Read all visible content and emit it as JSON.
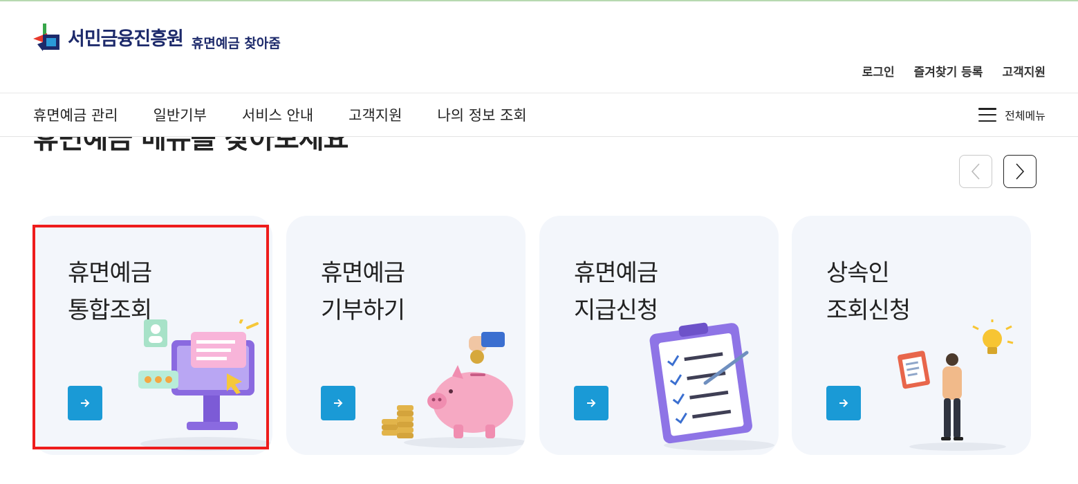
{
  "logo": {
    "org_name": "서민금융진흥원",
    "service_name": "휴면예금 찾아줌"
  },
  "util_links": [
    "로그인",
    "즐겨찾기 등록",
    "고객지원"
  ],
  "gnb": {
    "items": [
      "휴면예금 관리",
      "일반기부",
      "서비스 안내",
      "고객지원",
      "나의 정보 조회"
    ],
    "all_menu_label": "전체메뉴"
  },
  "section": {
    "title": "휴면예금 메뉴를 찾아보세요"
  },
  "cards": [
    {
      "line1": "휴면예금",
      "line2": "통합조회",
      "illustration": "computer-monitor-illustration",
      "highlighted": true
    },
    {
      "line1": "휴면예금",
      "line2": "기부하기",
      "illustration": "piggy-bank-coins-illustration",
      "highlighted": false
    },
    {
      "line1": "휴면예금",
      "line2": "지급신청",
      "illustration": "clipboard-checklist-illustration",
      "highlighted": false
    },
    {
      "line1": "상속인",
      "line2": "조회신청",
      "illustration": "person-idea-illustration",
      "highlighted": false
    }
  ],
  "colors": {
    "brand_navy": "#1d2a6b",
    "arrow_blue": "#1a9ad6",
    "card_bg": "#f3f6fb",
    "highlight_red": "#ee1c1c"
  }
}
